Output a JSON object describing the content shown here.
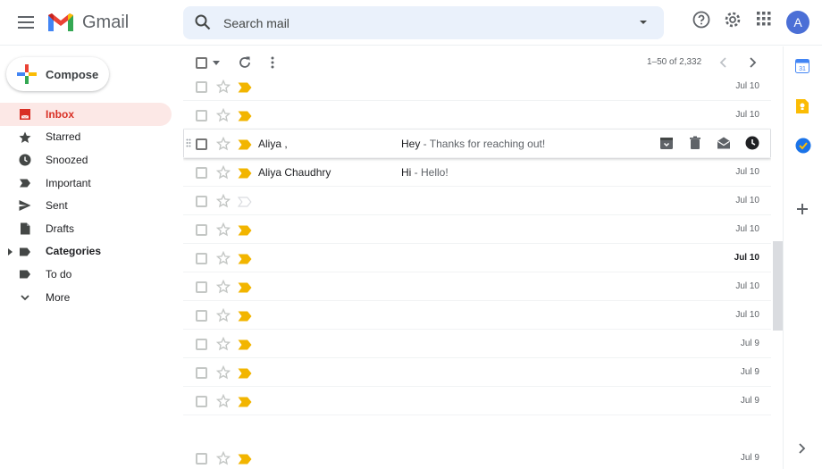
{
  "app": {
    "name": "Gmail"
  },
  "search": {
    "placeholder": "Search mail"
  },
  "account": {
    "initial": "A"
  },
  "compose": {
    "label": "Compose"
  },
  "nav": [
    {
      "label": "Inbox",
      "active": true
    },
    {
      "label": "Starred"
    },
    {
      "label": "Snoozed"
    },
    {
      "label": "Important"
    },
    {
      "label": "Sent"
    },
    {
      "label": "Drafts"
    },
    {
      "label": "Categories",
      "bold": true
    },
    {
      "label": "To do"
    },
    {
      "label": "More"
    }
  ],
  "pager": {
    "text": "1–50 of 2,332"
  },
  "emails": [
    {
      "sender": "",
      "subject": "",
      "snippet": "",
      "date": "Jul 10",
      "important": true
    },
    {
      "sender": "",
      "subject": "",
      "snippet": "",
      "date": "Jul 10",
      "important": true
    },
    {
      "sender": "Aliya ,",
      "subject": "Hey",
      "snippet": " - Thanks for reaching out!",
      "date": "",
      "important": true,
      "hovered": true
    },
    {
      "sender": "Aliya Chaudhry",
      "subject": "Hi",
      "snippet": " - Hello!",
      "date": "Jul 10",
      "important": true
    },
    {
      "sender": "",
      "subject": "",
      "snippet": "",
      "date": "Jul 10",
      "important": false
    },
    {
      "sender": "",
      "subject": "",
      "snippet": "",
      "date": "Jul 10",
      "important": true
    },
    {
      "sender": "",
      "subject": "",
      "snippet": "",
      "date": "Jul 10",
      "important": true,
      "unread": true
    },
    {
      "sender": "",
      "subject": "",
      "snippet": "",
      "date": "Jul 10",
      "important": true
    },
    {
      "sender": "",
      "subject": "",
      "snippet": "",
      "date": "Jul 10",
      "important": true
    },
    {
      "sender": "",
      "subject": "",
      "snippet": "",
      "date": "Jul 9",
      "important": true
    },
    {
      "sender": "",
      "subject": "",
      "snippet": "",
      "date": "Jul 9",
      "important": true
    },
    {
      "sender": "",
      "subject": "",
      "snippet": "",
      "date": "Jul 9",
      "important": true
    },
    {
      "sender": "",
      "subject": "",
      "snippet": "",
      "date": "Jul 9",
      "important": true
    }
  ],
  "colors": {
    "accent": "#d93025",
    "important": "#f2b500",
    "active_bg": "#fce8e6"
  }
}
